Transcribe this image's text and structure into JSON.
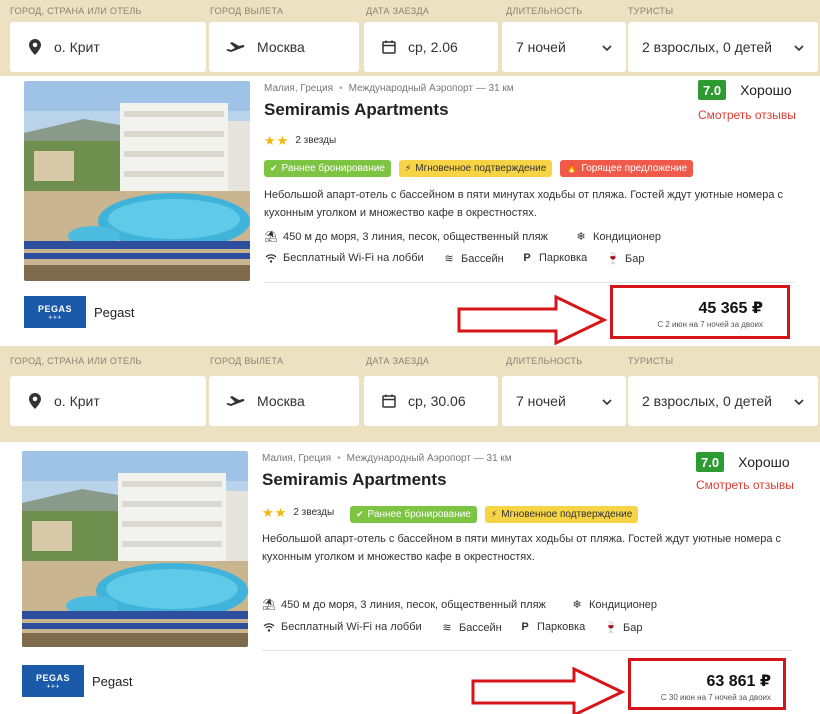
{
  "search_labels": {
    "destination": "Город, страна или отель",
    "departure": "Город вылета",
    "date": "Дата заезда",
    "duration": "Длительность",
    "tourists": "Туристы"
  },
  "search1": {
    "destination": "о. Крит",
    "departure": "Москва",
    "date": "ср, 2.06",
    "duration": "7 ночей",
    "tourists": "2 взрослых, 0 детей"
  },
  "search2": {
    "destination": "о. Крит",
    "departure": "Москва",
    "date": "ср, 30.06",
    "duration": "7 ночей",
    "tourists": "2 взрослых, 0 детей"
  },
  "hotel1": {
    "location": "Малия, Греция",
    "airport": "Международный Аэропорт — 31 км",
    "name": "Semiramis Apartments",
    "stars_count": 2,
    "stars_label": "2 звезды",
    "badges": [
      "Раннее бронирование",
      "Мгновенное подтверждение",
      "Горящее предложение"
    ],
    "description": "Небольшой апарт-отель с бассейном в пяти минутах ходьбы от пляжа. Гостей ждут уютные номера с кухонным уголком и множество кафе в окрестностях.",
    "beach": "450 м до моря, 3 линия, песок, общественный пляж",
    "ac": "Кондиционер",
    "wifi": "Бесплатный Wi-Fi на лобби",
    "pool": "Бассейн",
    "parking": "Парковка",
    "bar": "Бар",
    "rating": "7.0",
    "rating_word": "Хорошо",
    "reviews": "Смотреть отзывы",
    "operator": "Pegast",
    "operator_logo": "PEGAS",
    "price": "45 365 ₽",
    "price_note": "С 2 июн на 7 ночей за двоих"
  },
  "hotel2": {
    "location": "Малия, Греция",
    "airport": "Международный Аэропорт — 31 км",
    "name": "Semiramis Apartments",
    "stars_count": 2,
    "stars_label": "2 звезды",
    "badges": [
      "Раннее бронирование",
      "Мгновенное подтверждение"
    ],
    "description": "Небольшой апарт-отель с бассейном в пяти минутах ходьбы от пляжа. Гостей ждут уютные номера с кухонным уголком и множество кафе в окрестностях.",
    "beach": "450 м до моря, 3 линия, песок, общественный пляж",
    "ac": "Кондиционер",
    "wifi": "Бесплатный Wi-Fi на лобби",
    "pool": "Бассейн",
    "parking": "Парковка",
    "bar": "Бар",
    "rating": "7.0",
    "rating_word": "Хорошо",
    "reviews": "Смотреть отзывы",
    "operator": "Pegast",
    "operator_logo": "PEGAS",
    "price": "63 861 ₽",
    "price_note": "С 30 июн на 7 ночей за двоих"
  },
  "colors": {
    "search_bg": "#ece1c0",
    "highlight_red": "#d5151a",
    "rating_green": "#2e9b32",
    "reviews_red": "#e03c31"
  }
}
